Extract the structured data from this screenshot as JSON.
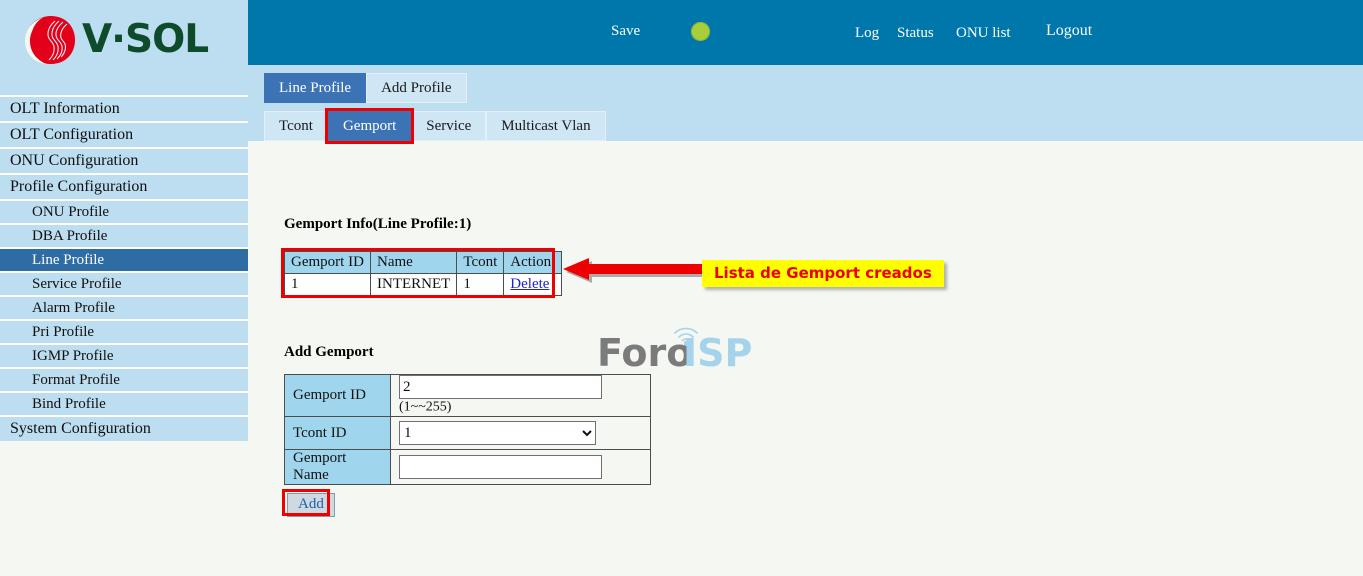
{
  "brand": {
    "logo_text": "V·SOL",
    "logo_icon": "vsol-sphere-logo"
  },
  "header": {
    "save_label": "Save",
    "status_dot": "status-indicator-green",
    "status_dot_color": "#a8ce3c",
    "links": [
      {
        "label": "Log"
      },
      {
        "label": "Status"
      },
      {
        "label": "ONU list"
      },
      {
        "label": "Logout"
      }
    ],
    "bar_color": "#0077ab"
  },
  "sidebar": {
    "items": [
      {
        "label": "OLT Information",
        "level": 0,
        "active": false
      },
      {
        "label": "OLT Configuration",
        "level": 0,
        "active": false
      },
      {
        "label": "ONU Configuration",
        "level": 0,
        "active": false
      },
      {
        "label": "Profile Configuration",
        "level": 0,
        "active": false
      },
      {
        "label": "ONU Profile",
        "level": 1,
        "active": false
      },
      {
        "label": "DBA Profile",
        "level": 1,
        "active": false
      },
      {
        "label": "Line Profile",
        "level": 1,
        "active": true
      },
      {
        "label": "Service Profile",
        "level": 1,
        "active": false
      },
      {
        "label": "Alarm Profile",
        "level": 1,
        "active": false
      },
      {
        "label": "Pri Profile",
        "level": 1,
        "active": false
      },
      {
        "label": "IGMP Profile",
        "level": 1,
        "active": false
      },
      {
        "label": "Format Profile",
        "level": 1,
        "active": false
      },
      {
        "label": "Bind Profile",
        "level": 1,
        "active": false
      },
      {
        "label": "System Configuration",
        "level": 0,
        "active": false
      }
    ]
  },
  "main": {
    "primary_tabs": [
      {
        "label": "Line Profile",
        "active": true
      },
      {
        "label": "Add Profile",
        "active": false
      }
    ],
    "secondary_tabs": [
      {
        "label": "Tcont",
        "active": false,
        "highlighted": false
      },
      {
        "label": "Gemport",
        "active": true,
        "highlighted": true
      },
      {
        "label": "Service",
        "active": false,
        "highlighted": false
      },
      {
        "label": "Multicast Vlan",
        "active": false,
        "highlighted": false
      }
    ],
    "info_section": {
      "title": "Gemport Info(Line Profile:1)",
      "columns": [
        "Gemport ID",
        "Name",
        "Tcont",
        "Action"
      ],
      "rows": [
        {
          "gemport_id": "1",
          "name": "INTERNET",
          "tcont": "1",
          "action": "Delete"
        }
      ]
    },
    "annotation": {
      "text": "Lista de Gemport creados",
      "background": "#ffff00",
      "text_color": "#ee0000",
      "arrow": "left-arrow-red"
    },
    "add_section": {
      "title": "Add Gemport",
      "fields": [
        {
          "label": "Gemport ID",
          "type": "text",
          "value": "2",
          "placeholder": "",
          "hint": "(1~~255)"
        },
        {
          "label": "Tcont ID",
          "type": "select",
          "value": "1",
          "options": [
            "1"
          ],
          "hint": ""
        },
        {
          "label": "Gemport Name",
          "type": "text",
          "value": "",
          "placeholder": "",
          "hint": ""
        }
      ],
      "submit_label": "Add"
    },
    "watermark": {
      "text_left": "Foro",
      "text_right": "ISP",
      "color_left": "#7b7b7b",
      "color_right": "#a6d3ec"
    }
  },
  "colors": {
    "page_bg": "#f4f7f2",
    "panel_blue": "#bddef1",
    "table_header": "#9fd6ee",
    "accent_tab": "#3b73b4",
    "highlight_red": "#ee0000"
  }
}
